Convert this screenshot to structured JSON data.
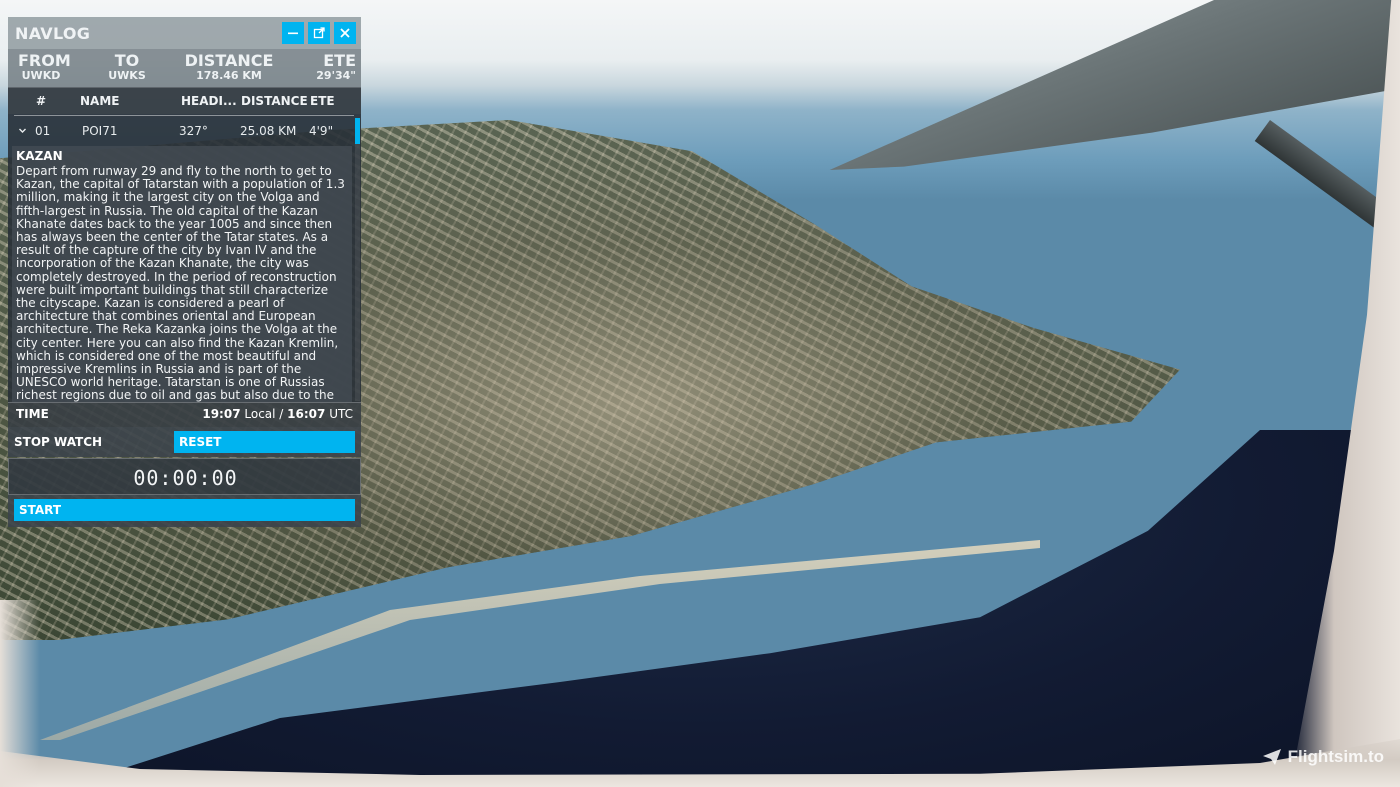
{
  "navlog": {
    "title": "NAVLOG",
    "controls": {
      "minimize_icon": "minimize-icon",
      "popout_icon": "popout-icon",
      "close_icon": "close-icon"
    },
    "summary": {
      "from_label": "FROM",
      "from_value": "UWKD",
      "to_label": "TO",
      "to_value": "UWKS",
      "distance_label": "DISTANCE",
      "distance_value": "178.46 KM",
      "ete_label": "ETE",
      "ete_value": "29'34\""
    },
    "columns": {
      "num": "#",
      "name": "NAME",
      "heading": "HEADI...",
      "distance": "DISTANCE",
      "ete": "ETE"
    },
    "rows": [
      {
        "num": "01",
        "name": "POI71",
        "heading": "327°",
        "distance": "25.08 KM",
        "ete": "4'9\""
      }
    ],
    "description": {
      "title": "KAZAN",
      "text": "Depart from runway 29 and fly to the north to get to Kazan, the capital of Tatarstan with a population of 1.3 million, making it the largest city on the Volga and fifth-largest in Russia. The old capital of the Kazan Khanate dates back to the year 1005 and since then has always been the center of the Tatar states. As a result of the capture of the city by Ivan IV and the incorporation of the Kazan Khanate, the city was completely destroyed. In the period of reconstruction were built important buildings that still characterize the cityscape. Kazan is considered a pearl of architecture that combines oriental and European architecture. The Reka Kazanka joins the Volga at the city center. Here you can also find the Kazan Kremlin, which is considered one of the most beautiful and impressive Kremlins in Russia and is part of the UNESCO world heritage. Tatarstan is one of Russias richest regions due to oil and gas but also due to the economic powerhouse of Kazan. Among other"
    },
    "time": {
      "label": "TIME",
      "local_time": "19:07",
      "local_label": "Local /",
      "utc_time": "16:07",
      "utc_label": "UTC"
    },
    "stopwatch": {
      "label": "STOP WATCH",
      "reset_label": "RESET",
      "clock": "00:00:00",
      "start_label": "START"
    }
  },
  "watermark": {
    "text": "Flightsim.to"
  },
  "colors": {
    "accent": "#00b4f0",
    "panel_header": "#919ba0",
    "panel_body": "#283037"
  }
}
